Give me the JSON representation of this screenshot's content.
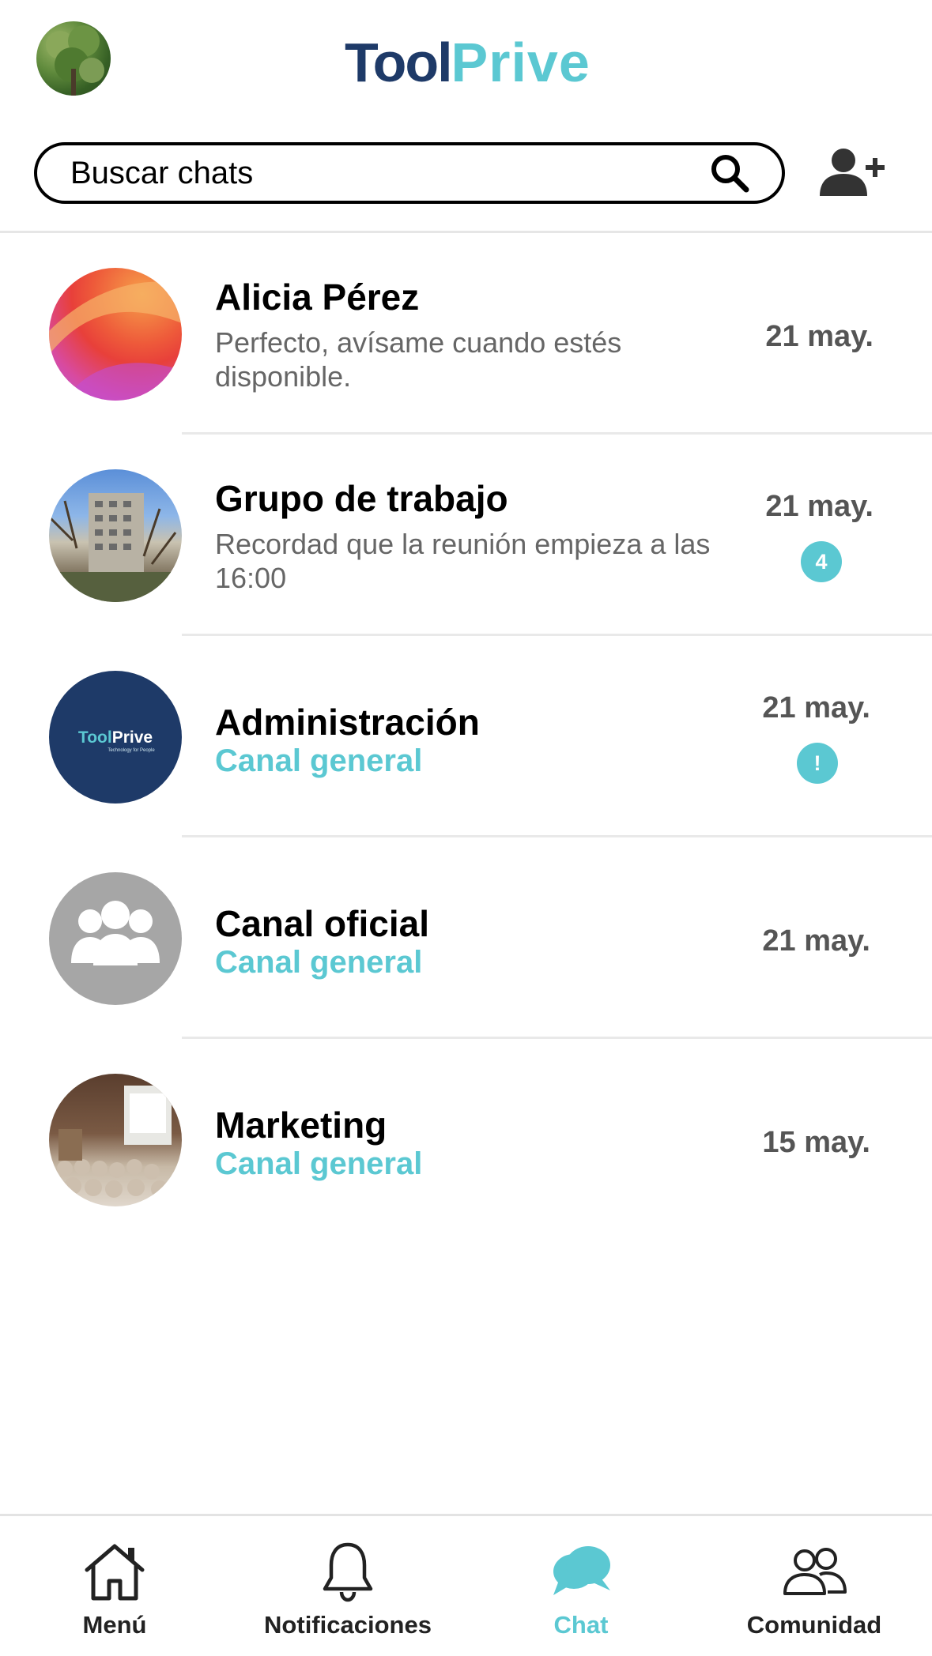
{
  "header": {
    "logo_part1": "Tool",
    "logo_part2": "Prive",
    "search_placeholder": "Buscar chats"
  },
  "colors": {
    "accent": "#5bc8d2",
    "logo_dark": "#1e3a68",
    "logo_light": "#5bc8d2"
  },
  "chats": [
    {
      "name": "Alicia Pérez",
      "preview": "Perfecto, avísame cuando estés disponible.",
      "date": "21 may."
    },
    {
      "name": "Grupo de trabajo",
      "preview": "Recordad que la reunión empieza a las 16:00",
      "date": "21 may.",
      "badge": "4"
    },
    {
      "name": "Administración",
      "channel": "Canal general",
      "date": "21 may.",
      "badge": "!",
      "avatar_logo_part1": "Tool",
      "avatar_logo_part2": "Prive",
      "avatar_tagline": "Technology for People"
    },
    {
      "name": "Canal oficial",
      "channel": "Canal general",
      "date": "21 may."
    },
    {
      "name": "Marketing",
      "channel": "Canal general",
      "date": "15 may."
    }
  ],
  "nav": {
    "menu": "Menú",
    "notifications": "Notificaciones",
    "chat": "Chat",
    "community": "Comunidad",
    "active": "chat"
  }
}
